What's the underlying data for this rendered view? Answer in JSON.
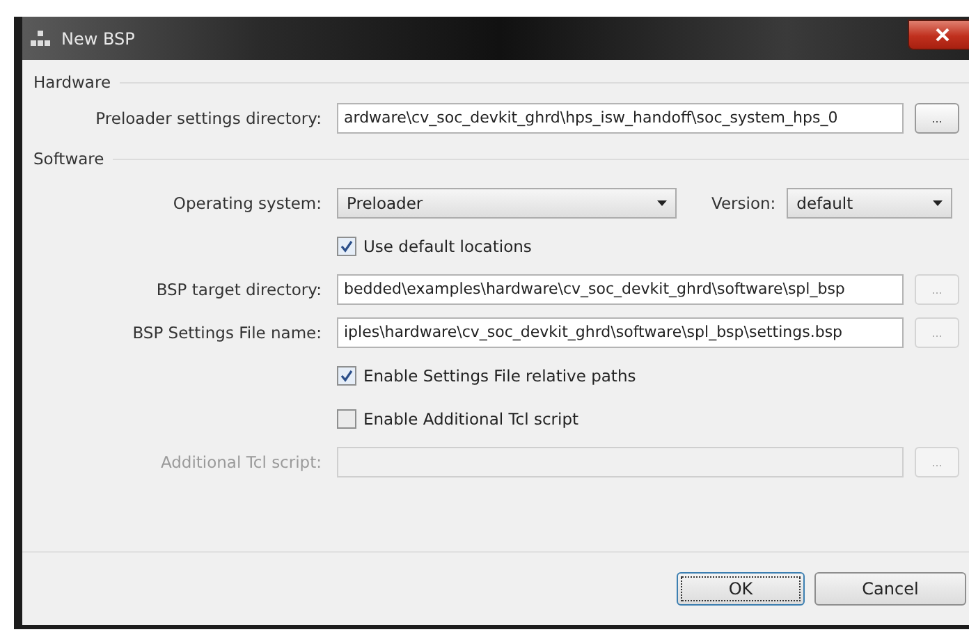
{
  "window": {
    "title": "New BSP"
  },
  "hardware": {
    "title": "Hardware",
    "rows": [
      {
        "kind": "path",
        "label": "Preloader settings directory:",
        "value": "ardware\\cv_soc_devkit_ghrd\\hps_isw_handoff\\soc_system_hps_0",
        "browse": "...",
        "disabled": false,
        "browse_disabled": false
      }
    ]
  },
  "software": {
    "title": "Software",
    "rows": [
      {
        "kind": "os",
        "label": "Operating system:",
        "value": "Preloader",
        "version_label": "Version:",
        "version_value": "default"
      },
      {
        "kind": "checkbox",
        "label": "Use default locations",
        "checked": true
      },
      {
        "kind": "path",
        "label": "BSP target directory:",
        "value": "bedded\\examples\\hardware\\cv_soc_devkit_ghrd\\software\\spl_bsp",
        "browse": "...",
        "disabled": false,
        "browse_disabled": true
      },
      {
        "kind": "path",
        "label": "BSP Settings File name:",
        "value": "iples\\hardware\\cv_soc_devkit_ghrd\\software\\spl_bsp\\settings.bsp",
        "browse": "...",
        "disabled": false,
        "browse_disabled": true
      },
      {
        "kind": "checkbox",
        "label": "Enable Settings File relative paths",
        "checked": true
      },
      {
        "kind": "checkbox",
        "label": "Enable Additional Tcl script",
        "checked": false
      },
      {
        "kind": "path",
        "label": "Additional Tcl script:",
        "value": "",
        "browse": "...",
        "disabled": true,
        "browse_disabled": true
      }
    ]
  },
  "buttons": [
    {
      "label": "OK",
      "focused": true
    },
    {
      "label": "Cancel",
      "focused": false
    }
  ]
}
